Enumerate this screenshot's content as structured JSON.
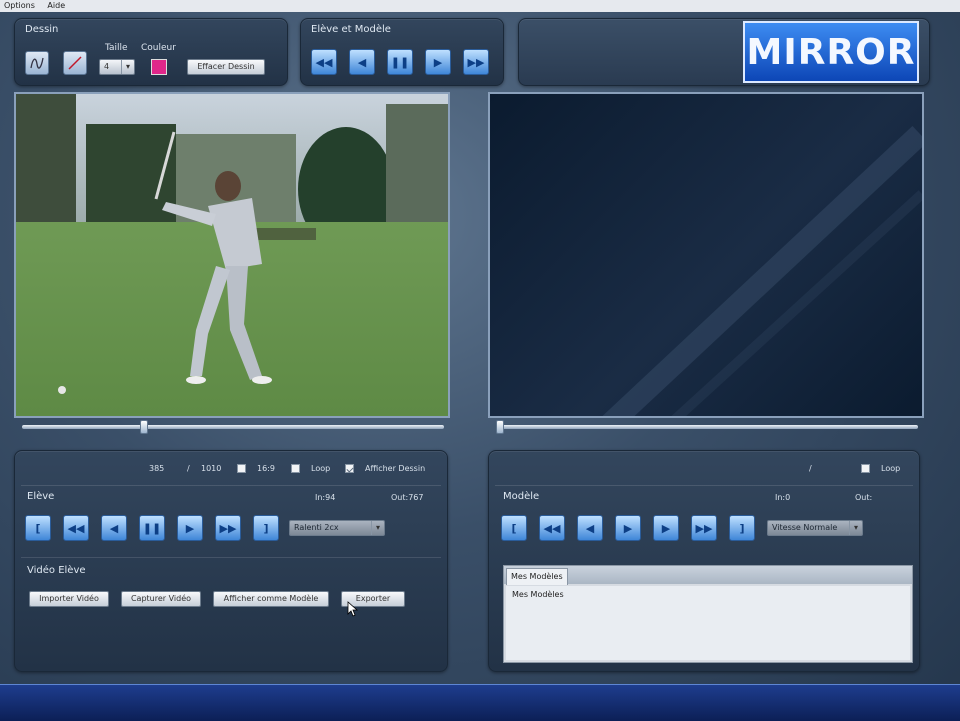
{
  "menubar": {
    "items": [
      "Options",
      "Aide"
    ]
  },
  "dessin": {
    "title": "Dessin",
    "taille_label": "Taille",
    "couleur_label": "Couleur",
    "taille_value": "4",
    "couleur_color": "#e0278a",
    "effacer_label": "Effacer Dessin"
  },
  "eleve_modele": {
    "title": "Elève et Modèle"
  },
  "logo": {
    "text": "MIRROR"
  },
  "left_controls": {
    "frame_current": "385",
    "frame_sep": "/",
    "frame_total": "1010",
    "ratio_label": "16:9",
    "loop_label": "Loop",
    "afficher_dessin_label": "Afficher Dessin",
    "section_title": "Elève",
    "in_label": "In:94",
    "out_label": "Out:767",
    "speed_value": "Ralenti 2cx",
    "video_section_title": "Vidéo Elève",
    "btn_importer": "Importer Vidéo",
    "btn_capturer": "Capturer Vidéo",
    "btn_afficher_modele": "Afficher comme Modèle",
    "btn_exporter": "Exporter"
  },
  "right_controls": {
    "frame_sep": "/",
    "loop_label": "Loop",
    "section_title": "Modèle",
    "in_label": "In:0",
    "out_label": "Out:",
    "speed_value": "Vitesse Normale",
    "tab_label": "Mes Modèles",
    "list_item": "Mes Modèles"
  },
  "colors": {
    "accent": "#3f86d8",
    "logo_bg": "#1a5fd0"
  }
}
